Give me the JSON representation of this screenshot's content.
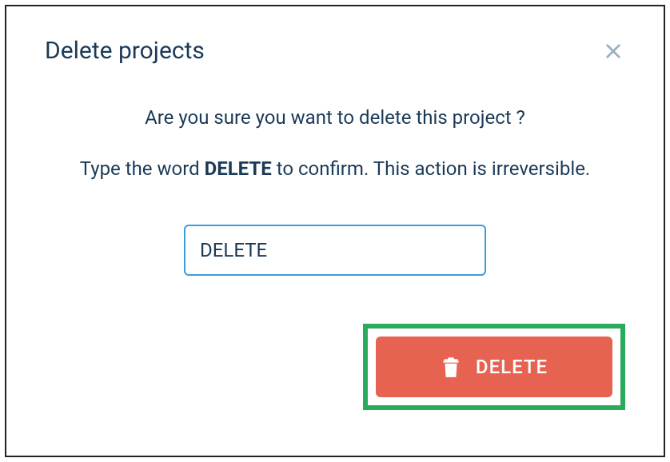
{
  "modal": {
    "title": "Delete projects",
    "question": "Are you sure you want to delete this project ?",
    "instruction_prefix": "Type the word ",
    "instruction_keyword": "DELETE",
    "instruction_suffix": " to confirm. This action is irreversible.",
    "input_value": "DELETE",
    "delete_button_label": "DELETE"
  },
  "colors": {
    "text_primary": "#1b3a57",
    "input_border": "#3a9fd8",
    "danger": "#e66352",
    "highlight": "#2aaa5b"
  }
}
